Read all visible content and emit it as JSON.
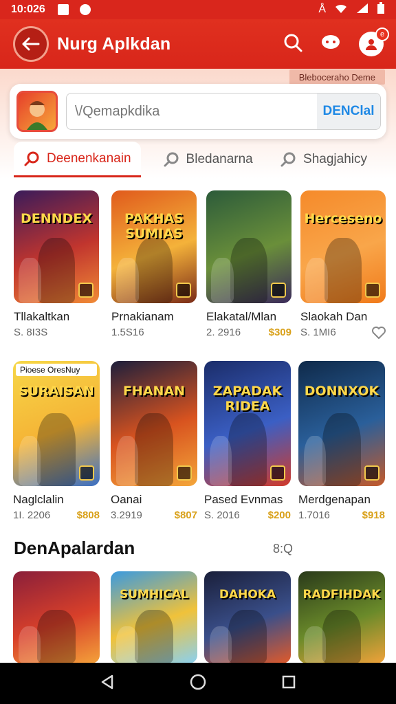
{
  "status_bar": {
    "time": "10:026"
  },
  "app_bar": {
    "title": "Nurg Aplkdan",
    "badge": "e"
  },
  "hint": "Bleboceraho Deme",
  "search": {
    "placeholder": "\\/Qemapkdika",
    "button": "DENClal"
  },
  "tabs": [
    {
      "label": "Deenenkanain",
      "active": true
    },
    {
      "label": "Bledanarna",
      "active": false
    },
    {
      "label": "Shagjahicy",
      "active": false
    }
  ],
  "row1": [
    {
      "art": "DENNDEX",
      "name": "Tllakaltkan",
      "size": "S. 8I3S",
      "price": "",
      "colors": [
        "#3a1b5a",
        "#c1352e",
        "#f08a36"
      ]
    },
    {
      "art": "PAKHAS SUMIAS",
      "name": "Prnakianam",
      "size": "1.5S16",
      "price": "",
      "colors": [
        "#e05a1c",
        "#f4b23a",
        "#7a2b17"
      ]
    },
    {
      "art": "",
      "name": "Elakatal/Mlan",
      "size": "2. 2916",
      "price": "$309",
      "colors": [
        "#2c5b3a",
        "#6a8f3a",
        "#3b2a5a"
      ]
    },
    {
      "art": "Herceseno",
      "name": "Slaokah Dan",
      "size": "S. 1MI6",
      "price": "",
      "colors": [
        "#f58a2a",
        "#f9a64a",
        "#f07a1a"
      ]
    }
  ],
  "row2": [
    {
      "art": "SURAISAN",
      "tag": "Pioese OresNuy",
      "name": "Naglclalin",
      "size": "1I. 2206",
      "price": "$808",
      "colors": [
        "#f6d748",
        "#f5b436",
        "#3a6fc4"
      ]
    },
    {
      "art": "FHANAN",
      "name": "Oanai",
      "size": "3.2919",
      "price": "$807",
      "colors": [
        "#1d1f3c",
        "#d8531f",
        "#f4a63a"
      ]
    },
    {
      "art": "ZAPADAK RIDEA",
      "name": "Pased Evnmas",
      "size": "S. 2016",
      "price": "$200",
      "colors": [
        "#1b2d6a",
        "#3b5fc4",
        "#d23a2a"
      ]
    },
    {
      "art": "DONNXOK",
      "name": "Merdgenapan",
      "size": "1.7016",
      "price": "$918",
      "colors": [
        "#0f2a4a",
        "#2a5f9a",
        "#c45a2a"
      ]
    }
  ],
  "section": {
    "title": "DenApalardan",
    "more": "8:Q"
  },
  "row3": [
    {
      "art": "",
      "colors": [
        "#8a1f3a",
        "#d8402a",
        "#f4a23a"
      ]
    },
    {
      "art": "SUMHICAL",
      "colors": [
        "#3a9ae0",
        "#f0c23a",
        "#8ad0f0"
      ]
    },
    {
      "art": "DAHOKA",
      "colors": [
        "#1a1f3a",
        "#3a4f8a",
        "#e05a2a"
      ]
    },
    {
      "art": "RADFIHDAK",
      "colors": [
        "#2a3a1a",
        "#6a8a2a",
        "#f0a23a"
      ]
    }
  ],
  "colors": {
    "primary": "#d8261a",
    "accent_blue": "#1e88e5",
    "price": "#d9a11b"
  }
}
